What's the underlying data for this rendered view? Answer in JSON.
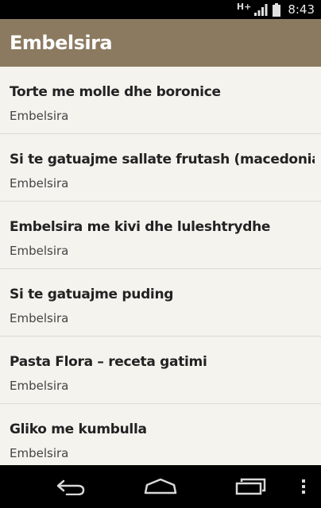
{
  "status_bar": {
    "network_type": "H+",
    "time": "8:43",
    "icons": [
      "signal-icon",
      "battery-icon"
    ]
  },
  "action_bar": {
    "title": "Embelsira",
    "background_color": "#8b7a60"
  },
  "list": {
    "items": [
      {
        "title": "Torte me molle dhe boronice",
        "category": "Embelsira"
      },
      {
        "title": "Si te gatuajme sallate frutash (macedonia)",
        "category": "Embelsira"
      },
      {
        "title": "Embelsira me kivi dhe luleshtrydhe",
        "category": "Embelsira"
      },
      {
        "title": "Si te gatuajme puding",
        "category": "Embelsira"
      },
      {
        "title": "Pasta Flora – receta gatimi",
        "category": "Embelsira"
      },
      {
        "title": "Gliko me kumbulla",
        "category": "Embelsira"
      }
    ]
  },
  "nav_bar": {
    "icons": [
      "back-icon",
      "home-icon",
      "recents-icon",
      "overflow-menu-icon"
    ]
  }
}
